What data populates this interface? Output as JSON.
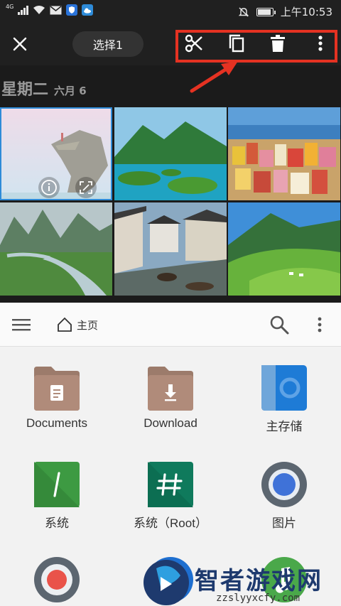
{
  "status_bar": {
    "network": "4G",
    "time": "上午10:53",
    "battery_level": 0.9
  },
  "action_bar": {
    "select_label": "选择1",
    "close_icon": "close-icon",
    "tools": [
      "cut-icon",
      "copy-icon",
      "delete-icon",
      "more-vertical-icon"
    ],
    "highlight_color": "#e53222"
  },
  "gallery": {
    "date": {
      "day": "星期二",
      "month": "六月 6"
    },
    "selected_color": "#2e8bd8",
    "selected_count": 1
  },
  "file_manager": {
    "toolbar": {
      "home_label": "主页"
    },
    "items": [
      {
        "label": "Documents"
      },
      {
        "label": "Download"
      },
      {
        "label": "主存储"
      },
      {
        "label": "系统"
      },
      {
        "label": "系统（Root）"
      },
      {
        "label": "图片"
      }
    ]
  },
  "watermark": {
    "title": "智者游戏网",
    "url": "zzslyyxcfy.com"
  }
}
